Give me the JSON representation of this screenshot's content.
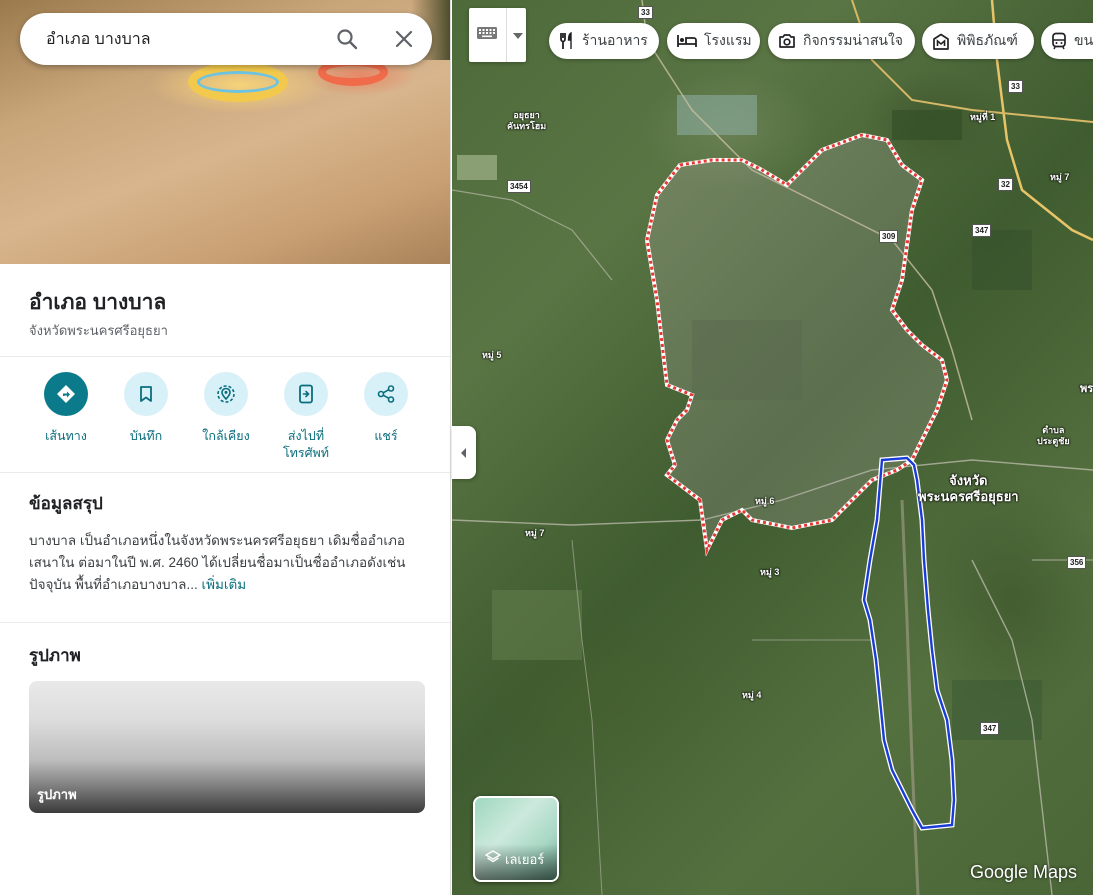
{
  "search": {
    "value": "อำเภอ บางบาล"
  },
  "place": {
    "title": "อำเภอ บางบาล",
    "subtitle": "จังหวัดพระนครศรีอยุธยา"
  },
  "actions": [
    {
      "label": "เส้นทาง",
      "icon": "directions-icon"
    },
    {
      "label": "บันทึก",
      "icon": "bookmark-icon"
    },
    {
      "label": "ใกล้เคียง",
      "icon": "nearby-icon"
    },
    {
      "label": "ส่งไปที่โทรศัพท์",
      "icon": "send-to-phone-icon"
    },
    {
      "label": "แชร์",
      "icon": "share-icon"
    }
  ],
  "summary": {
    "heading": "ข้อมูลสรุป",
    "text": "บางบาล เป็นอำเภอหนึ่งในจังหวัดพระนครศรีอยุธยา เดิมชื่ออำเภอเสนาใน ต่อมาในปี พ.ศ. 2460 ได้เปลี่ยนชื่อมาเป็นชื่ออำเภอดังเช่นปัจจุบัน พื้นที่อำเภอบางบาล... ",
    "more": "เพิ่มเติม"
  },
  "photos": {
    "heading": "รูปภาพ",
    "card_label": "รูปภาพ"
  },
  "chips": [
    {
      "label": "ร้านอาหาร",
      "icon": "restaurant-icon"
    },
    {
      "label": "โรงแรม",
      "icon": "hotel-icon"
    },
    {
      "label": "กิจกรรมน่าสนใจ",
      "icon": "camera-icon"
    },
    {
      "label": "พิพิธภัณฑ์",
      "icon": "museum-icon"
    },
    {
      "label": "ขน",
      "icon": "transit-icon"
    }
  ],
  "map_labels": {
    "ayutthaya_khanthon": "อยุธยา\nคันทรโฮม",
    "mu1": "หมู่ที่ 1",
    "mu7_ne": "หมู่ 7",
    "mu5": "หมู่ 5",
    "mu6": "หมู่ 6",
    "mu7_w": "หมู่ 7",
    "mu3": "หมู่ 3",
    "mu4": "หมู่ 4",
    "province": "จังหวัด\nพระนครศรีอยุธยา",
    "tambon": "ตำบล\nประตูชัย",
    "edge_label": "พร"
  },
  "road_shields": {
    "r33_top": "33",
    "r33": "33",
    "r32": "32",
    "r3454": "3454",
    "r309": "309",
    "r347_top": "347",
    "r347_bottom": "347",
    "r356": "356"
  },
  "layers": {
    "label": "เลเยอร์"
  },
  "logo": "Google Maps",
  "colors": {
    "accent": "#0b7b8b",
    "boundary_red": "#e53935",
    "boundary_blue": "#1a3cd6"
  }
}
